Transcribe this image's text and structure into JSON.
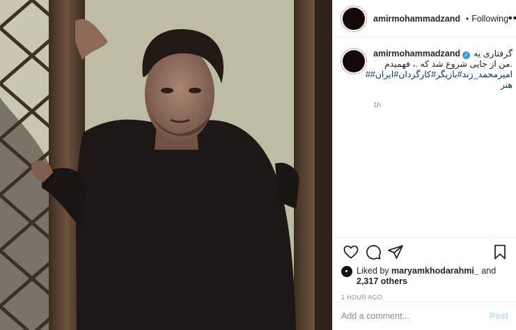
{
  "header": {
    "username": "amirmohammadzand",
    "separator": "•",
    "follow_label": "Following",
    "more_label": "•••"
  },
  "caption": {
    "username": "amirmohammadzand",
    "verified_glyph": "✓",
    "line1": "گرفتاری یه",
    "line2": ".من از جایی شروع شد که .، فهمیدم",
    "hashtags": "امیرمحمد_زند#بازیگر#کارگردان#ایران##",
    "hashtags2": "هنر",
    "time": "1h"
  },
  "actions": {
    "like_icon": "heart-icon",
    "comment_icon": "comment-icon",
    "share_icon": "share-icon",
    "save_icon": "bookmark-icon"
  },
  "likes": {
    "prefix": "Liked by",
    "user": "maryamkhodarahmi_",
    "conj": "and",
    "others": "2,317 others"
  },
  "post_time": "1 HOUR AGO",
  "comment_box": {
    "placeholder": "Add a comment...",
    "post_label": "Post"
  },
  "colors": {
    "accent": "#3897f0",
    "post_disabled": "#b2dffc",
    "muted": "#8e8e8e"
  }
}
